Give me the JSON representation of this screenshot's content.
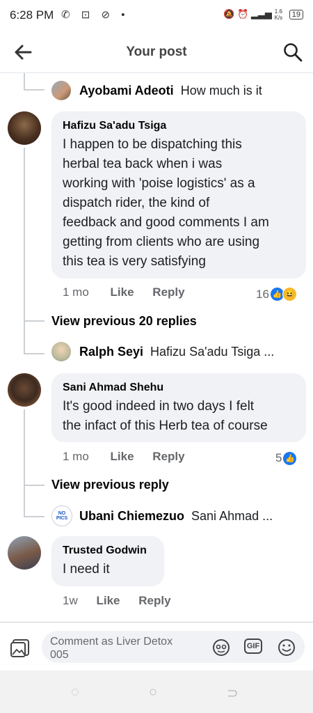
{
  "status": {
    "time": "6:28 PM",
    "speed_value": "1.6",
    "speed_unit": "K/s",
    "battery": "19"
  },
  "header": {
    "title": "Your post"
  },
  "comments": [
    {
      "name": "Hafizu Sa'adu Tsiga",
      "lines": [
        "I happen to be dispatching this",
        "herbal tea back when i was",
        "working with 'poise logistics' as a",
        "dispatch rider,  the kind of",
        "feedback and good comments I am",
        "getting from clients who are using",
        "this tea is very satisfying"
      ],
      "time": "1 mo",
      "like": "Like",
      "reply": "Reply",
      "reaction_count": "16",
      "view_previous": "View previous 20 replies",
      "reply_preview": {
        "name": "Ralph Seyi",
        "text": "Hafizu Sa'adu Tsiga ..."
      }
    },
    {
      "name": "Sani Ahmad Shehu",
      "lines": [
        "It's good indeed in two days I felt",
        "the infact of this Herb tea of course"
      ],
      "time": "1 mo",
      "like": "Like",
      "reply": "Reply",
      "reaction_count": "5",
      "view_previous": "View previous reply",
      "reply_preview": {
        "name": "Ubani Chiemezuo",
        "text": "Sani Ahmad ..."
      }
    },
    {
      "name": "Trusted Godwin",
      "lines": [
        "I need it"
      ],
      "time": "1w",
      "like": "Like",
      "reply": "Reply"
    }
  ],
  "top_reply": {
    "name": "Ayobami Adeoti",
    "text": "How much is it"
  },
  "composer": {
    "placeholder_line1": "Comment as Liver Detox",
    "placeholder_line2": "005",
    "gif_label": "GIF"
  },
  "avatar_badge_text": [
    "NO",
    "PICS"
  ],
  "colors": {
    "like_blue": "#1877f2",
    "bubble_grey": "#f0f2f5"
  }
}
